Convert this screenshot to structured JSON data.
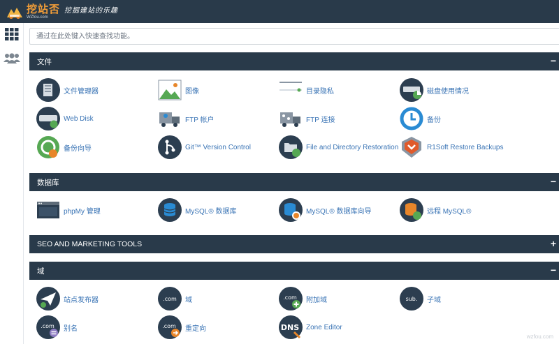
{
  "brand": {
    "name": "挖站否",
    "domain": "WZfou.com",
    "slogan": "挖掘建站的乐趣",
    "brand_color": "#f29d38",
    "topbar_color": "#293a4a"
  },
  "sidebar": {
    "items": [
      {
        "icon": "grid-icon"
      },
      {
        "icon": "users-icon"
      }
    ]
  },
  "search": {
    "placeholder": "通过在此处键入快速查找功能。",
    "value": ""
  },
  "sections": {
    "files": {
      "title": "文件",
      "toggle": "−",
      "tools": [
        {
          "label": "文件管理器",
          "icon": "file-manager-icon"
        },
        {
          "label": "图像",
          "icon": "images-icon"
        },
        {
          "label": "目录隐私",
          "icon": "directory-privacy-icon"
        },
        {
          "label": "磁盘使用情况",
          "icon": "disk-usage-icon"
        },
        {
          "label": "Web Disk",
          "icon": "web-disk-icon"
        },
        {
          "label": "FTP 帐户",
          "icon": "ftp-accounts-icon"
        },
        {
          "label": "FTP 连接",
          "icon": "ftp-connections-icon"
        },
        {
          "label": "备份",
          "icon": "backup-icon"
        },
        {
          "label": "备份向导",
          "icon": "backup-wizard-icon"
        },
        {
          "label": "Git™ Version Control",
          "icon": "git-icon"
        },
        {
          "label": "File and Directory Restoration",
          "icon": "file-restoration-icon"
        },
        {
          "label": "R1Soft Restore Backups",
          "icon": "r1soft-icon"
        }
      ]
    },
    "databases": {
      "title": "数据库",
      "toggle": "−",
      "tools": [
        {
          "label": "phpMy 管理",
          "icon": "phpmyadmin-icon"
        },
        {
          "label": "MySQL® 数据库",
          "icon": "mysql-databases-icon"
        },
        {
          "label": "MySQL® 数据库向导",
          "icon": "mysql-wizard-icon"
        },
        {
          "label": "远程 MySQL®",
          "icon": "remote-mysql-icon"
        }
      ]
    },
    "seo": {
      "title": "SEO AND MARKETING TOOLS",
      "toggle": "+"
    },
    "domains": {
      "title": "域",
      "toggle": "−",
      "tools": [
        {
          "label": "站点发布器",
          "icon": "site-publisher-icon"
        },
        {
          "label": "域",
          "icon": "domains-icon"
        },
        {
          "label": "附加域",
          "icon": "addon-domains-icon"
        },
        {
          "label": "子域",
          "icon": "subdomains-icon"
        },
        {
          "label": "别名",
          "icon": "aliases-icon"
        },
        {
          "label": "重定向",
          "icon": "redirects-icon"
        },
        {
          "label": "Zone Editor",
          "icon": "zone-editor-icon"
        }
      ]
    }
  },
  "icon_text": {
    "com": ".com",
    "sub": "sub.",
    "dns": "DNS"
  },
  "watermark": "wzfou.com",
  "colors": {
    "link": "#3a74b5",
    "icon_dark": "#2c3e50",
    "icon_green": "#56a853",
    "icon_blue": "#2a8bd3",
    "icon_orange": "#e8862a"
  }
}
